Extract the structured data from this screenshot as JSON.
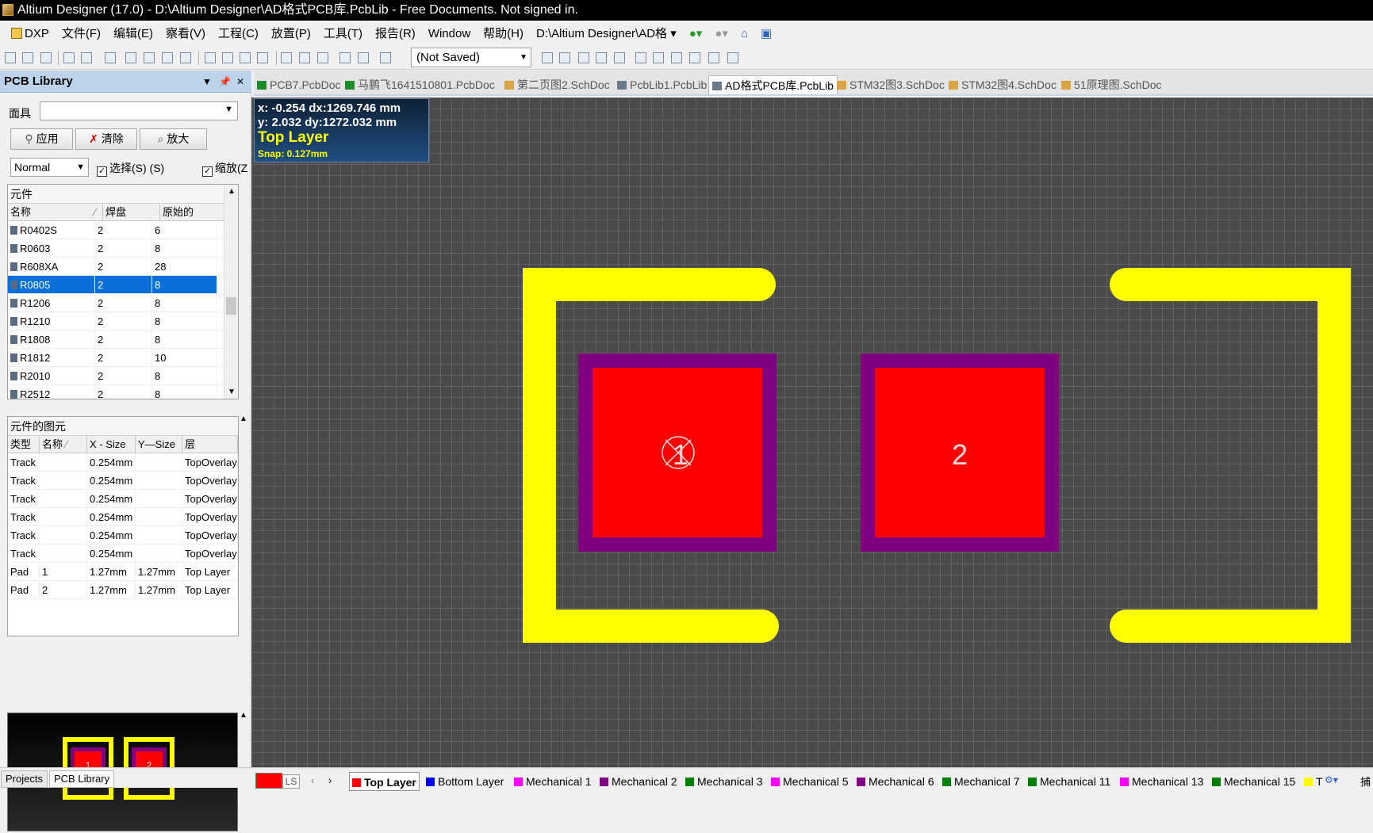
{
  "window": {
    "title": "Altium Designer (17.0) - D:\\Altium Designer\\AD格式PCB库.PcbLib - Free Documents. Not signed in."
  },
  "menu": [
    "DXP",
    "文件(F)",
    "编辑(E)",
    "察看(V)",
    "工程(C)",
    "放置(P)",
    "工具(T)",
    "报告(R)",
    "Window",
    "帮助(H)"
  ],
  "path_combo": "D:\\Altium Designer\\AD格",
  "toolbar": {
    "save_state": "(Not Saved)"
  },
  "panel": {
    "title": "PCB Library",
    "mask_label": "面具",
    "mask_value": "",
    "apply_label": "应用",
    "clear_label": "清除",
    "zoom_label": "放大",
    "mode": "Normal",
    "select_label": "选择(S) (S)",
    "zoom_check_label": "缩放(Z",
    "components": {
      "title": "元件",
      "columns": [
        "名称",
        "焊盘",
        "原始的"
      ],
      "rows": [
        {
          "name": "R0402S",
          "pads": "2",
          "prims": "6"
        },
        {
          "name": "R0603",
          "pads": "2",
          "prims": "8"
        },
        {
          "name": "R608XA",
          "pads": "2",
          "prims": "28"
        },
        {
          "name": "R0805",
          "pads": "2",
          "prims": "8"
        },
        {
          "name": "R1206",
          "pads": "2",
          "prims": "8"
        },
        {
          "name": "R1210",
          "pads": "2",
          "prims": "8"
        },
        {
          "name": "R1808",
          "pads": "2",
          "prims": "8"
        },
        {
          "name": "R1812",
          "pads": "2",
          "prims": "10"
        },
        {
          "name": "R2010",
          "pads": "2",
          "prims": "8"
        },
        {
          "name": "R2512",
          "pads": "2",
          "prims": "8"
        }
      ],
      "selected": "R0805"
    },
    "primitives": {
      "title": "元件的图元",
      "columns": [
        "类型",
        "名称",
        "X - Size",
        "Y—Size",
        "层"
      ],
      "rows": [
        {
          "type": "Track",
          "name": "",
          "x": "0.254mm",
          "y": "",
          "layer": "TopOverlay"
        },
        {
          "type": "Track",
          "name": "",
          "x": "0.254mm",
          "y": "",
          "layer": "TopOverlay"
        },
        {
          "type": "Track",
          "name": "",
          "x": "0.254mm",
          "y": "",
          "layer": "TopOverlay"
        },
        {
          "type": "Track",
          "name": "",
          "x": "0.254mm",
          "y": "",
          "layer": "TopOverlay"
        },
        {
          "type": "Track",
          "name": "",
          "x": "0.254mm",
          "y": "",
          "layer": "TopOverlay"
        },
        {
          "type": "Track",
          "name": "",
          "x": "0.254mm",
          "y": "",
          "layer": "TopOverlay"
        },
        {
          "type": "Pad",
          "name": "1",
          "x": "1.27mm",
          "y": "1.27mm",
          "layer": "Top Layer"
        },
        {
          "type": "Pad",
          "name": "2",
          "x": "1.27mm",
          "y": "1.27mm",
          "layer": "Top Layer"
        }
      ]
    },
    "preview_pads": [
      "1",
      "2"
    ],
    "tabs": [
      "Projects",
      "PCB Library"
    ]
  },
  "doc_tabs": [
    {
      "label": "PCB7.PcbDoc",
      "color": "#1f8a2c"
    },
    {
      "label": "马鹏飞1641510801.PcbDoc",
      "color": "#1f8a2c"
    },
    {
      "label": "第二页图2.SchDoc",
      "color": "#d9a441"
    },
    {
      "label": "PcbLib1.PcbLib",
      "color": "#6a7a8a"
    },
    {
      "label": "AD格式PCB库.PcbLib",
      "color": "#6a7a8a"
    },
    {
      "label": "STM32图3.SchDoc",
      "color": "#d9a441"
    },
    {
      "label": "STM32图4.SchDoc",
      "color": "#d9a441"
    },
    {
      "label": "51原理图.SchDoc",
      "color": "#d9a441"
    }
  ],
  "active_doc": "AD格式PCB库.PcbLib",
  "hud": {
    "x_line": "x: -0.254   dx:1269.746 mm",
    "y_line": "y:  2.032   dy:1272.032 mm",
    "layer": "Top Layer",
    "snap": "Snap: 0.127mm"
  },
  "footprint": {
    "pad1": "1",
    "pad2": "2",
    "overlay_color": "#ffff00",
    "pad_color": "#ff0000",
    "solder_color": "#800080"
  },
  "layers": {
    "current_swatch": "#ff0000",
    "ls_label": "LS",
    "items": [
      {
        "name": "Top Layer",
        "color": "#ff0000"
      },
      {
        "name": "Bottom Layer",
        "color": "#0000ff"
      },
      {
        "name": "Mechanical 1",
        "color": "#ff00ff"
      },
      {
        "name": "Mechanical 2",
        "color": "#800080"
      },
      {
        "name": "Mechanical 3",
        "color": "#008000"
      },
      {
        "name": "Mechanical 5",
        "color": "#ff00ff"
      },
      {
        "name": "Mechanical 6",
        "color": "#800080"
      },
      {
        "name": "Mechanical 7",
        "color": "#008000"
      },
      {
        "name": "Mechanical 11",
        "color": "#008000"
      },
      {
        "name": "Mechanical 13",
        "color": "#ff00ff"
      },
      {
        "name": "Mechanical 15",
        "color": "#008000"
      },
      {
        "name": "T",
        "color": "#ffff00"
      }
    ],
    "snap_label": "捕"
  }
}
